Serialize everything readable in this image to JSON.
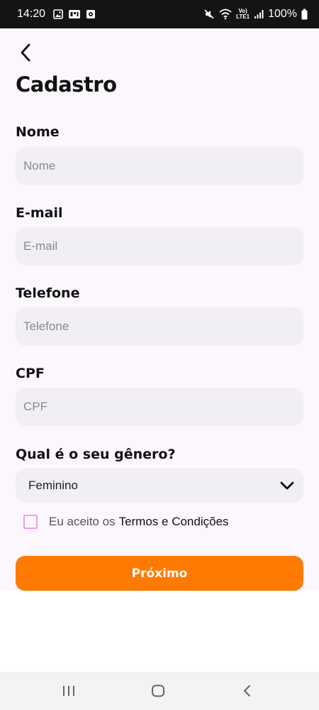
{
  "status_bar": {
    "time": "14:20",
    "battery_percent": "100%",
    "volte_top": "Vo)",
    "volte_bottom": "LTE1",
    "icons": [
      "image-icon",
      "alert-badge-icon",
      "media-icon",
      "mute-icon",
      "wifi-icon",
      "signal-icon",
      "battery-icon"
    ]
  },
  "header": {
    "back_icon": "chevron-left-icon",
    "title": "Cadastro"
  },
  "form": {
    "name": {
      "label": "Nome",
      "placeholder": "Nome",
      "value": ""
    },
    "email": {
      "label": "E-mail",
      "placeholder": "E-mail",
      "value": ""
    },
    "phone": {
      "label": "Telefone",
      "placeholder": "Telefone",
      "value": ""
    },
    "cpf": {
      "label": "CPF",
      "placeholder": "CPF",
      "value": ""
    },
    "gender": {
      "label": "Qual é o seu gênero?",
      "selected": "Feminino",
      "chevron_icon": "chevron-down-icon"
    },
    "terms": {
      "checked": false,
      "text": "Eu aceito os",
      "link": "Termos e Condições"
    },
    "next_label": "Próximo"
  },
  "colors": {
    "accent": "#ff7a00",
    "checkbox_border": "#e9a1e6",
    "input_background": "#f1eff3",
    "page_background": "#fbf7fd"
  },
  "nav_bar": {
    "icons": [
      "recent-apps-icon",
      "home-icon",
      "back-icon"
    ]
  }
}
